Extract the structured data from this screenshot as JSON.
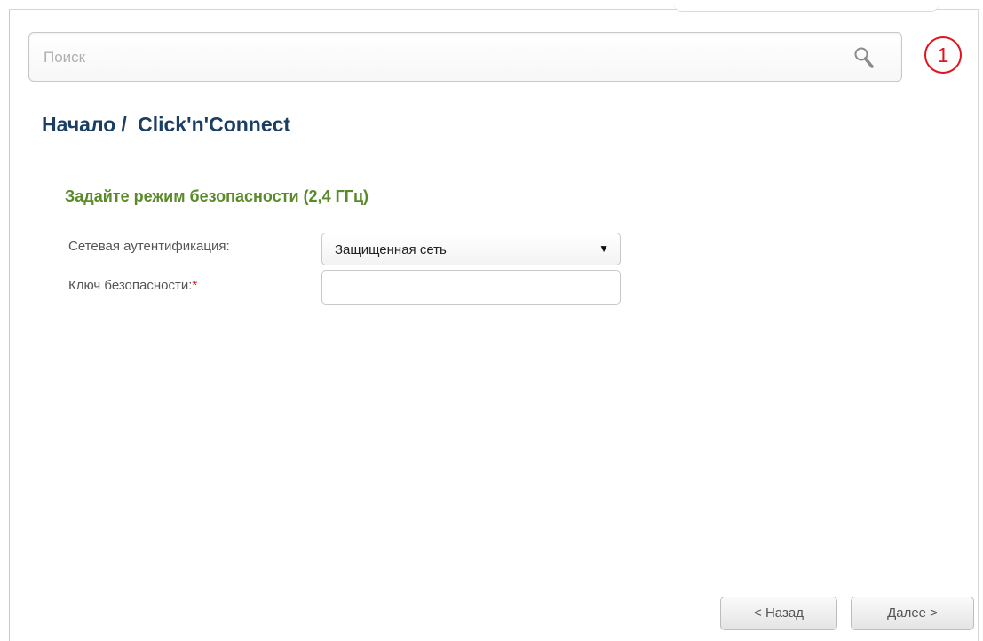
{
  "search": {
    "placeholder": "Поиск"
  },
  "notification": {
    "count": "1"
  },
  "breadcrumb": {
    "home": "Начало",
    "separator": "/",
    "current": "Click'n'Connect"
  },
  "section": {
    "title": "Задайте режим безопасности (2,4 ГГц)"
  },
  "form": {
    "auth_label": "Сетевая аутентификация:",
    "auth_value": "Защищенная сеть",
    "key_label": "Ключ безопасности:",
    "key_required_mark": "*",
    "key_value": ""
  },
  "buttons": {
    "back": "< Назад",
    "next": "Далее >"
  },
  "colors": {
    "title": "#1b3e63",
    "section": "#5a8a2a",
    "notification": "#e0141e"
  },
  "icons": {
    "search": "search-icon",
    "dropdown": "caret-down-icon"
  }
}
